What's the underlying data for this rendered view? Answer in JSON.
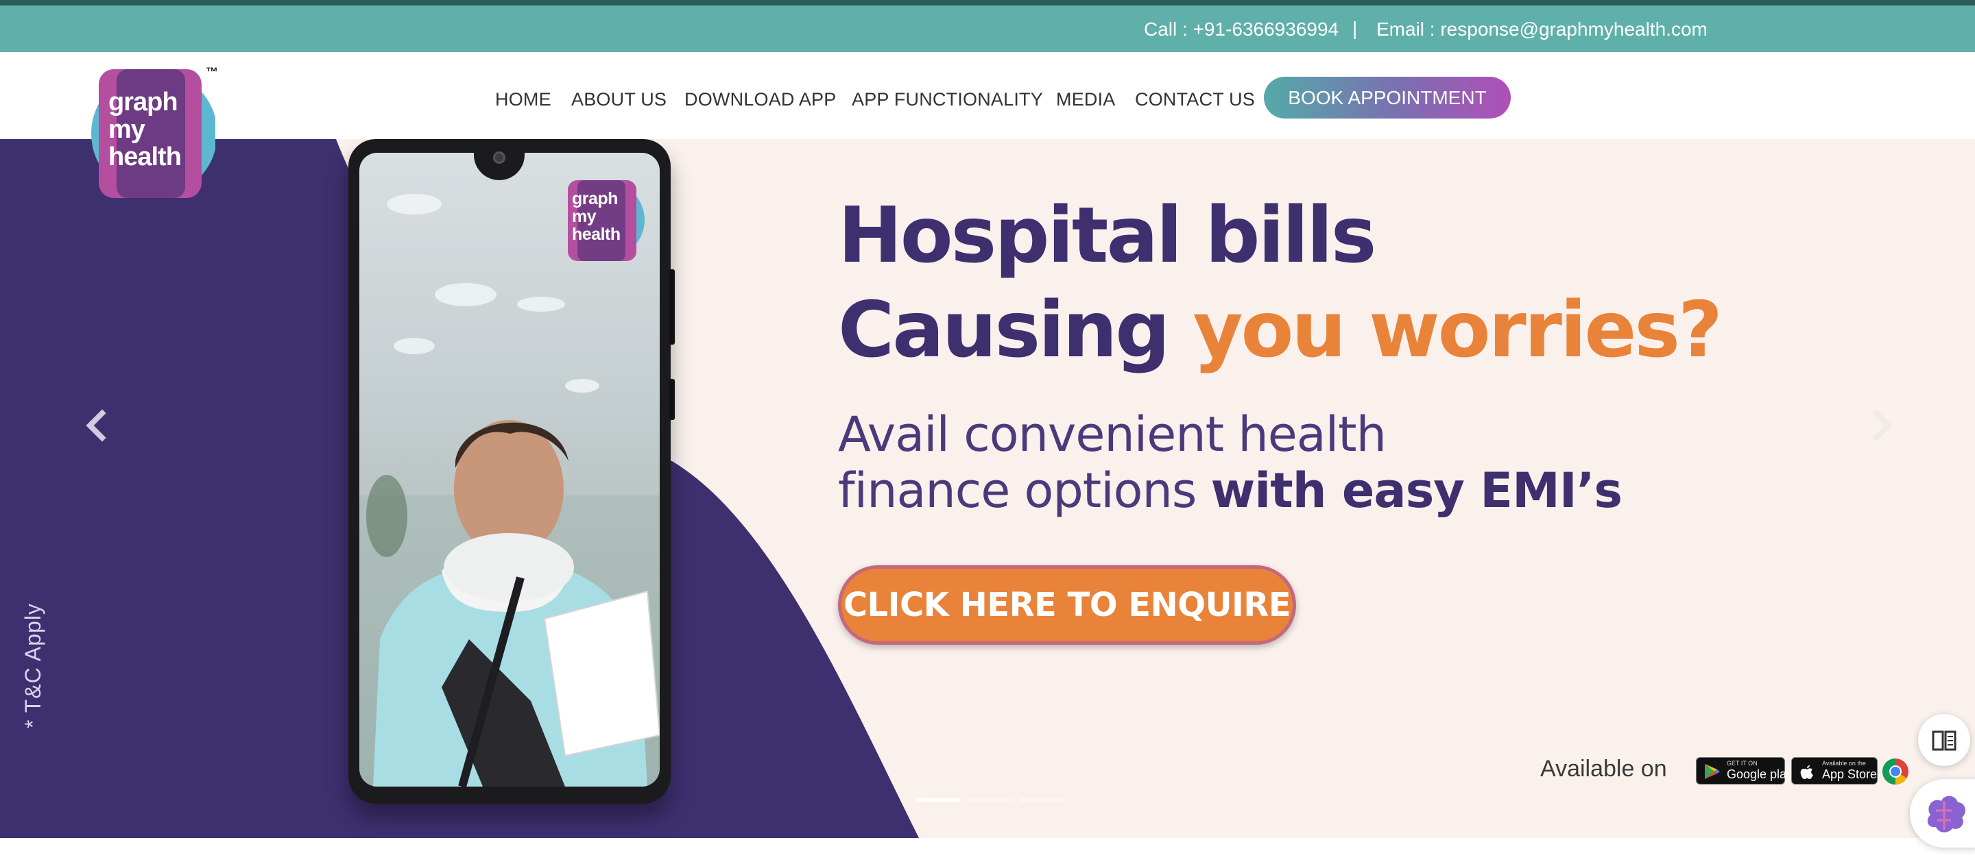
{
  "topbar": {
    "call": "Call : +91-6366936994",
    "separator": "|",
    "email": "Email : response@graphmyhealth.com"
  },
  "brand": {
    "logo_line1": "graph",
    "logo_line2": "my",
    "logo_line3": "health",
    "trademark": "™",
    "colors": {
      "teal": "#5fafaa",
      "purple": "#3e2f6f",
      "orange": "#e9833a",
      "magenta": "#b04fb8"
    }
  },
  "nav": {
    "items": [
      {
        "label": "HOME"
      },
      {
        "label": "ABOUT US"
      },
      {
        "label": "DOWNLOAD APP"
      },
      {
        "label": "APP FUNCTIONALITY"
      },
      {
        "label": "MEDIA"
      },
      {
        "label": "CONTACT US"
      }
    ],
    "cta": "BOOK APPOINTMENT"
  },
  "hero": {
    "headline_line1": "Hospital bills",
    "headline_line2_a": "Causing ",
    "headline_line2_b": "you worries?",
    "sub_line1": "Avail convenient health",
    "sub_line2_a": "finance options ",
    "sub_line2_b": "with easy EMI’s",
    "enquire_button": "CLICK HERE TO ENQUIRE",
    "tc": "* T&C Apply",
    "available_on": "Available on",
    "google_play_small": "GET IT ON",
    "google_play": "Google play",
    "app_store_small": "Available on the",
    "app_store": "App Store",
    "slide_count": 3,
    "active_slide": 1,
    "phone_logo_line1": "graph",
    "phone_logo_line2": "my",
    "phone_logo_line3": "health"
  },
  "icons": [
    "chevron-left-icon",
    "chevron-right-icon",
    "google-play-icon",
    "apple-icon",
    "chrome-icon",
    "book-icon",
    "brain-icon"
  ]
}
